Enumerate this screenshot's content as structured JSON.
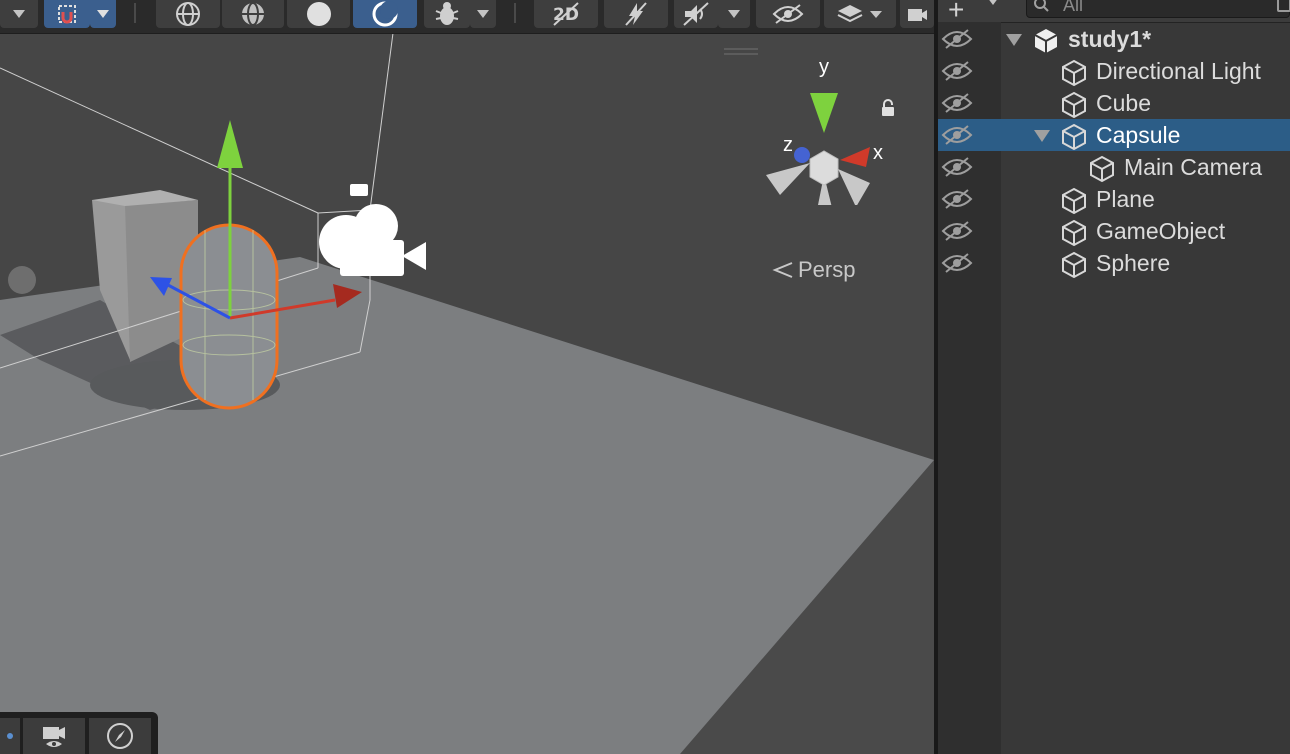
{
  "scene_view": {
    "toolbar": {
      "buttons": [
        {
          "name": "dropdown-arrow-icon"
        },
        {
          "name": "snap-icon",
          "active": true
        },
        {
          "name": "dropdown-arrow-icon",
          "active": true
        },
        {
          "name": "wireframe-globe-icon"
        },
        {
          "name": "shaded-wireframe-icon"
        },
        {
          "name": "shaded-sphere-icon"
        },
        {
          "name": "lit-render-icon",
          "active": true
        },
        {
          "name": "debug-bug-icon"
        },
        {
          "name": "dropdown-arrow-icon"
        },
        {
          "name": "2d-toggle-icon"
        },
        {
          "name": "lighting-toggle-icon"
        },
        {
          "name": "audio-toggle-icon"
        },
        {
          "name": "dropdown-arrow-icon"
        },
        {
          "name": "scene-visibility-icon"
        },
        {
          "name": "layers-icon"
        },
        {
          "name": "camera-icon"
        }
      ]
    },
    "gizmo": {
      "y_label": "y",
      "x_label": "x",
      "z_label": "z",
      "projection_label": "Persp"
    },
    "bottom_overlay": [
      "camera-preview-icon",
      "navigation-compass-icon"
    ]
  },
  "hierarchy": {
    "search_placeholder": "All",
    "items": [
      {
        "label": "study1*",
        "depth": 0,
        "type": "scene",
        "expanded": true
      },
      {
        "label": "Directional Light",
        "depth": 1
      },
      {
        "label": "Cube",
        "depth": 1
      },
      {
        "label": "Capsule",
        "depth": 1,
        "selected": true,
        "expanded": true
      },
      {
        "label": "Main Camera",
        "depth": 2
      },
      {
        "label": "Plane",
        "depth": 1
      },
      {
        "label": "GameObject",
        "depth": 1
      },
      {
        "label": "Sphere",
        "depth": 1
      }
    ]
  },
  "colors": {
    "selection": "#2c5d87",
    "toolbar_active": "#3b5f8e",
    "gizmo_x": "#d03a2a",
    "gizmo_y": "#7ed23e",
    "gizmo_z": "#2d52e6",
    "outline": "#f07020"
  }
}
